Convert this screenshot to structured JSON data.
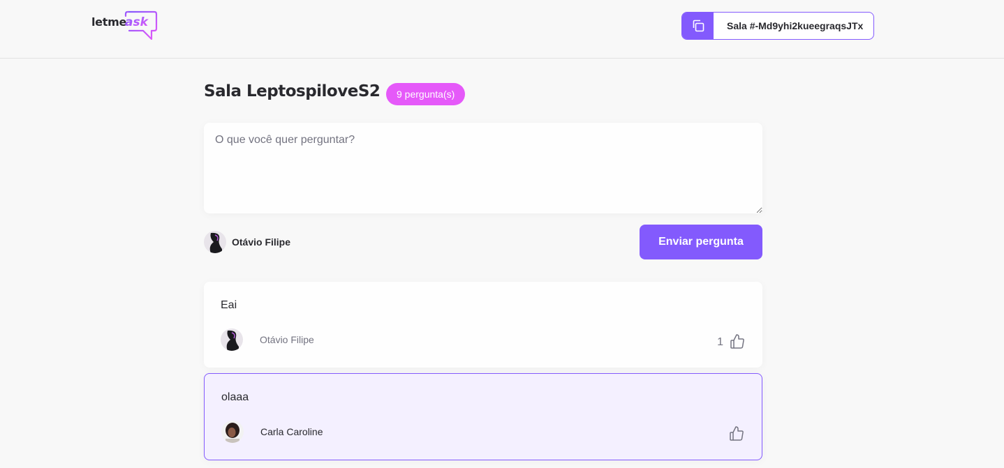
{
  "header": {
    "logo": {
      "part1": "letme",
      "part2": "ask"
    },
    "room_code_label": "Sala #-Md9yhi2kueegraqsJTx"
  },
  "room": {
    "title": "Sala LeptospiloveS2",
    "question_count": "9 pergunta(s)"
  },
  "form": {
    "placeholder": "O que você quer perguntar?",
    "user_name": "Otávio Filipe",
    "submit_label": "Enviar pergunta"
  },
  "questions": [
    {
      "content": "Eai",
      "author": "Otávio Filipe",
      "likes": "1",
      "highlighted": false
    },
    {
      "content": "olaaa",
      "author": "Carla Caroline",
      "likes": "",
      "highlighted": true
    }
  ],
  "colors": {
    "primary": "#835afd",
    "badge": "#e559f9",
    "background": "#f8f8f8",
    "highlight_bg": "#f4f0ff",
    "text": "#29292e",
    "muted": "#737380"
  },
  "icons": {
    "copy": "copy-icon",
    "like": "thumbs-up-icon"
  }
}
